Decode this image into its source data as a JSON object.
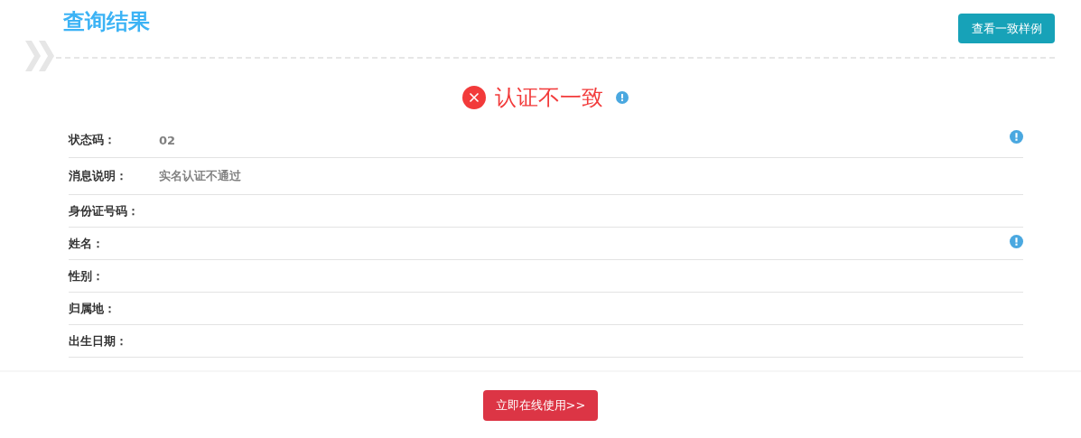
{
  "header": {
    "title": "查询结果",
    "sample_button": "查看一致样例"
  },
  "result": {
    "kind": "error",
    "text": "认证不一致",
    "hint": true
  },
  "fields": [
    {
      "label": "状态码：",
      "value": "02",
      "hint": true
    },
    {
      "label": "消息说明：",
      "value": "实名认证不通过",
      "hint": false
    },
    {
      "label": "身份证号码：",
      "hint": false
    },
    {
      "label": "姓名：",
      "hint": true
    },
    {
      "label": "性别：",
      "hint": false
    },
    {
      "label": "归属地：",
      "hint": false
    },
    {
      "label": "出生日期：",
      "hint": false
    }
  ],
  "footer": {
    "use_button": "立即在线使用>>"
  }
}
